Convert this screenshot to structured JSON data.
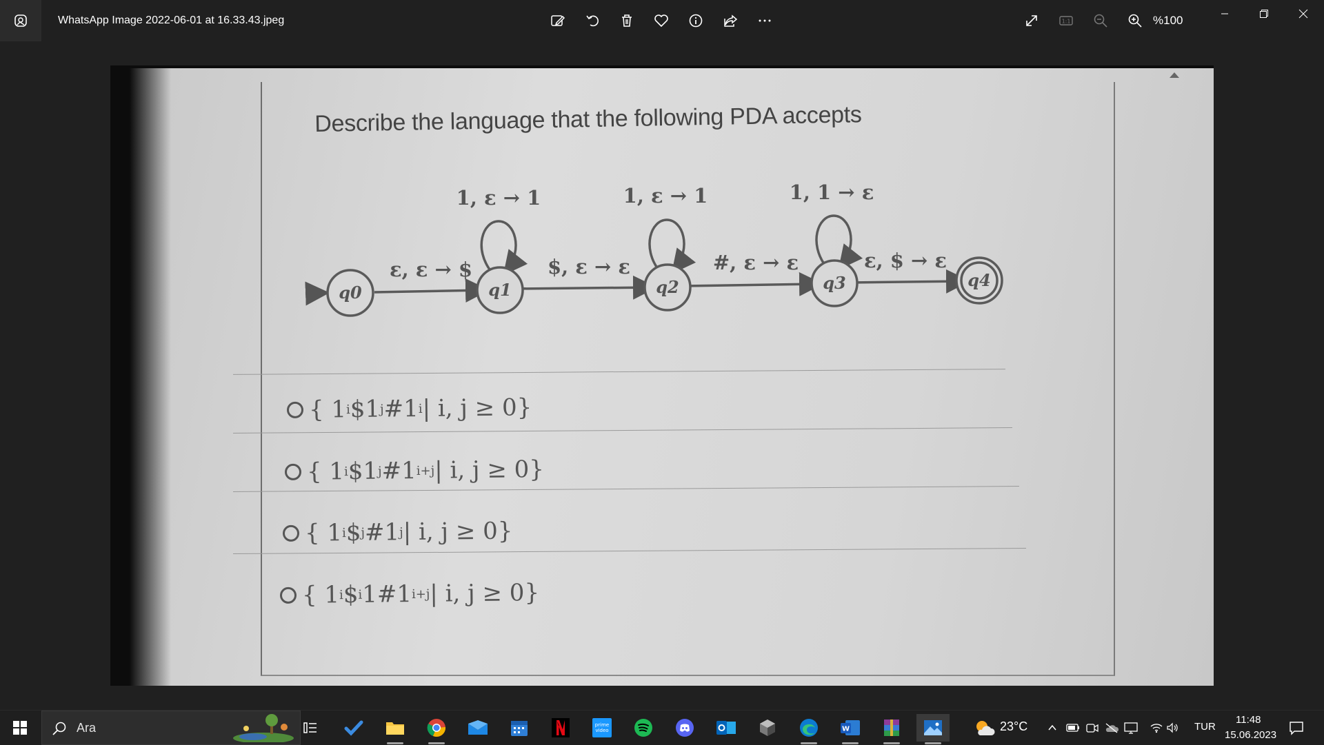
{
  "titlebar": {
    "filename": "WhatsApp Image 2022-06-01 at 16.33.43.jpeg",
    "zoom": "%100",
    "tools": [
      "edit-icon",
      "rotate-icon",
      "delete-icon",
      "favorite-icon",
      "info-icon",
      "share-icon",
      "more-icon"
    ],
    "view_tools": [
      "fullscreen-icon",
      "actual-size-icon",
      "zoom-out-icon",
      "zoom-in-icon"
    ],
    "window": [
      "minimize-icon",
      "restore-icon",
      "close-icon"
    ]
  },
  "photo": {
    "question": "Describe the language that the following PDA accepts",
    "states": [
      "q0",
      "q1",
      "q2",
      "q3",
      "q4"
    ],
    "transitions": {
      "start": "ε, ε → $",
      "q1_loop": "1, ε → 1",
      "q1_q2": "$, ε → ε",
      "q2_loop": "1, ε → 1",
      "q2_q3": "#, ε → ε",
      "q3_loop": "1, 1 → ε",
      "q3_q4": "ε, $ → ε"
    },
    "options": [
      {
        "set_open": "{ 1",
        "e1": "i",
        "mid1": "$1",
        "e2": "j",
        "mid2": "#1",
        "e3": "i",
        "cond": " | i, j ≥ 0}"
      },
      {
        "set_open": "{ 1",
        "e1": "i",
        "mid1": "$1",
        "e2": "j",
        "mid2": "#1",
        "e3": "i+j",
        "cond": " | i, j ≥ 0}"
      },
      {
        "set_open": "{ 1",
        "e1": "i",
        "mid1": "$",
        "e2": "j",
        "mid2": "#1",
        "e3": "j",
        "cond": " | i, j ≥ 0}"
      },
      {
        "set_open": "{ 1",
        "e1": "i",
        "mid1": "$",
        "e2": "i",
        "mid2": "1#1",
        "e3": "i+j",
        "cond": " | i, j ≥ 0}"
      }
    ]
  },
  "taskbar": {
    "search_placeholder": "Ara",
    "temperature": "23°C",
    "language": "TUR",
    "time": "11:48",
    "date": "15.06.2023"
  }
}
